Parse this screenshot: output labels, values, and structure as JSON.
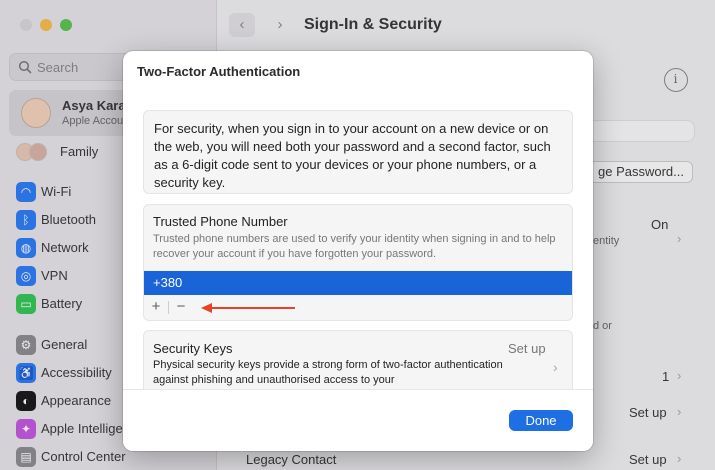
{
  "sidebar": {
    "search_placeholder": "Search",
    "account_name": "Asya Karap",
    "account_subtitle": "Apple Accou",
    "family_label": "Family",
    "items": [
      {
        "label": "Wi-Fi",
        "icon": "wifi-icon",
        "color": "#2f7cf6",
        "glyph": "◠"
      },
      {
        "label": "Bluetooth",
        "icon": "bluetooth-icon",
        "color": "#2f7cf6",
        "glyph": "ᛒ"
      },
      {
        "label": "Network",
        "icon": "globe-icon",
        "color": "#2f7cf6",
        "glyph": "◍"
      },
      {
        "label": "VPN",
        "icon": "vpn-icon",
        "color": "#2f7cf6",
        "glyph": "◎"
      },
      {
        "label": "Battery",
        "icon": "battery-icon",
        "color": "#36c659",
        "glyph": "▭"
      },
      {
        "label": "General",
        "icon": "gear-icon",
        "color": "#8e8d92",
        "glyph": "⚙"
      },
      {
        "label": "Accessibility",
        "icon": "accessibility-icon",
        "color": "#2f7cf6",
        "glyph": "♿"
      },
      {
        "label": "Appearance",
        "icon": "appearance-icon",
        "color": "#1c1c1e",
        "glyph": "◐"
      },
      {
        "label": "Apple Intellige",
        "icon": "apple-intelligence-icon",
        "color": "#c45ae0",
        "glyph": "✦"
      },
      {
        "label": "Control Center",
        "icon": "control-center-icon",
        "color": "#8e8d92",
        "glyph": "▤"
      }
    ]
  },
  "content": {
    "title": "Sign-In & Security",
    "back_glyph": "‹",
    "forward_glyph": "›",
    "info_glyph": "i",
    "change_password_partial": "ge Password...",
    "on_label": "On",
    "identity_partial": "entity",
    "d_or_partial": "d or",
    "count_value": "1",
    "setup_label_1": "Set up",
    "setup_label_2": "Set up",
    "legacy_contact": "Legacy Contact",
    "chevron": "›"
  },
  "sheet": {
    "title": "Two-Factor Authentication",
    "intro": "For security, when you sign in to your account on a new device or on the web, you will need both your password and a second factor, such as a 6-digit code sent to your devices or your phone numbers, or a security key.",
    "trusted_phone": {
      "title": "Trusted Phone Number",
      "description": "Trusted phone numbers are used to verify your identity when signing in and to help recover your account if you have forgotten your password.",
      "numbers": [
        "+380"
      ],
      "add_label": "+",
      "remove_label": "−"
    },
    "security_keys": {
      "title": "Security Keys",
      "status": "Set up",
      "description": "Physical security keys provide a strong form of two-factor authentication against phishing and unauthorised access to your",
      "chevron": "›"
    },
    "done_label": "Done"
  },
  "colors": {
    "accent": "#1d6fe3",
    "selection": "#1964d7",
    "annotation_arrow": "#e8412c"
  }
}
